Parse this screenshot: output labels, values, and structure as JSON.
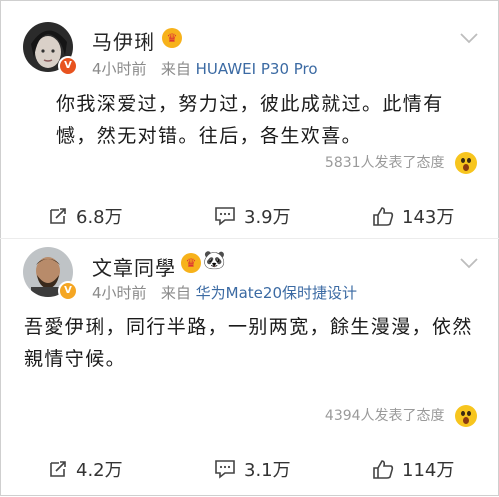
{
  "posts": [
    {
      "author": "马伊琍",
      "time": "4小时前",
      "source_prefix": "来自",
      "source": "HUAWEI P30 Pro",
      "content_lines": [
        "你我深爱过，努力过，彼此成就过。此情有",
        "憾，然无对错。往后，各生欢喜。"
      ],
      "reaction_text": "5831人发表了态度",
      "repost_count": "6.8万",
      "comment_count": "3.9万",
      "like_count": "143万",
      "badge_color": "#e8531f"
    },
    {
      "author": "文章同學",
      "time": "4小时前",
      "source_prefix": "来自",
      "source": "华为Mate20保时捷设计",
      "content_lines": [
        "吾愛伊琍，同行半路，一别两宽，餘生漫漫，依然",
        "親情守候。"
      ],
      "reaction_text": "4394人发表了态度",
      "repost_count": "4.2万",
      "comment_count": "3.1万",
      "like_count": "114万",
      "badge_color": "#f5a623"
    }
  ],
  "icons": {
    "repost": "repost-icon",
    "comment": "comment-icon",
    "like": "like-icon",
    "more": "chevron-down-icon",
    "crown": "crown-emoji-icon",
    "panda": "panda-icon",
    "reaction": "surprised-emoji-icon"
  }
}
